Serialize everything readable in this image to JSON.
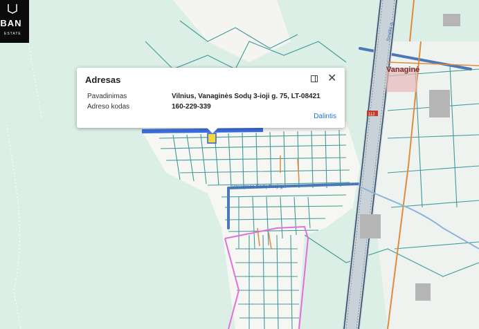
{
  "logo": {
    "word": "RBAN",
    "sub": "ESTATE"
  },
  "popup": {
    "title": "Adresas",
    "fields": [
      {
        "label": "Pavadinimas",
        "value": "Vilnius, Vanaginės Sodų 3-ioji g. 75, LT-08421"
      },
      {
        "label": "Adreso kodas",
        "value": "160-229-339"
      }
    ],
    "share_label": "Dalintis",
    "maximize_icon": "maximize-icon",
    "close_icon": "close-icon"
  },
  "map_labels": {
    "district": "Vanaginė",
    "route": "112",
    "street_vertical": "Smėlio g.",
    "street_horizontal": "Vanaginės Sodų 3-ioji g."
  },
  "colors": {
    "background": "#dcefe6",
    "parcel_outline": "#1f8a8a",
    "road_blue": "#4a78b8",
    "boundary_pink": "#e070d8",
    "boundary_orange": "#e08a3a",
    "selected": "#3a6fe0",
    "accent_link": "#1a73d9"
  }
}
